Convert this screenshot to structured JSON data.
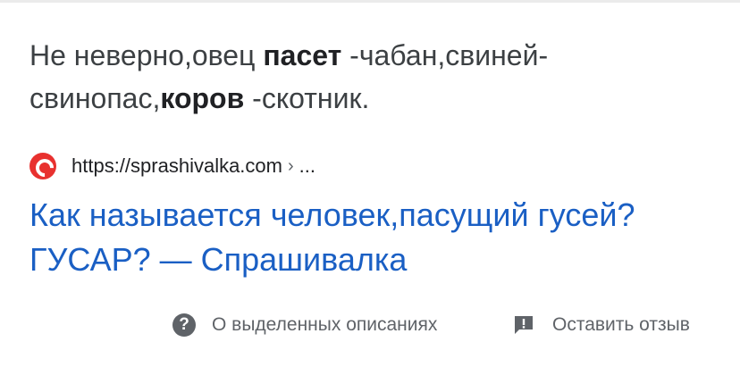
{
  "snippet": {
    "part1": "Не неверно,овец ",
    "bold1": "пасет",
    "part2": " -чабан,свиней-свинопас,",
    "bold2": "коров",
    "part3": " -скотник."
  },
  "source": {
    "url": "https://sprashivalka.com",
    "separator": "›",
    "more": "...",
    "favicon_color": "#e8312f"
  },
  "result": {
    "title": "Как называется человек,пасущий гусей?ГУСАР? — Спрашивалка",
    "link_color": "#1a5fc4"
  },
  "footer": {
    "about_label": "О выделенных описаниях",
    "feedback_label": "Оставить отзыв"
  }
}
